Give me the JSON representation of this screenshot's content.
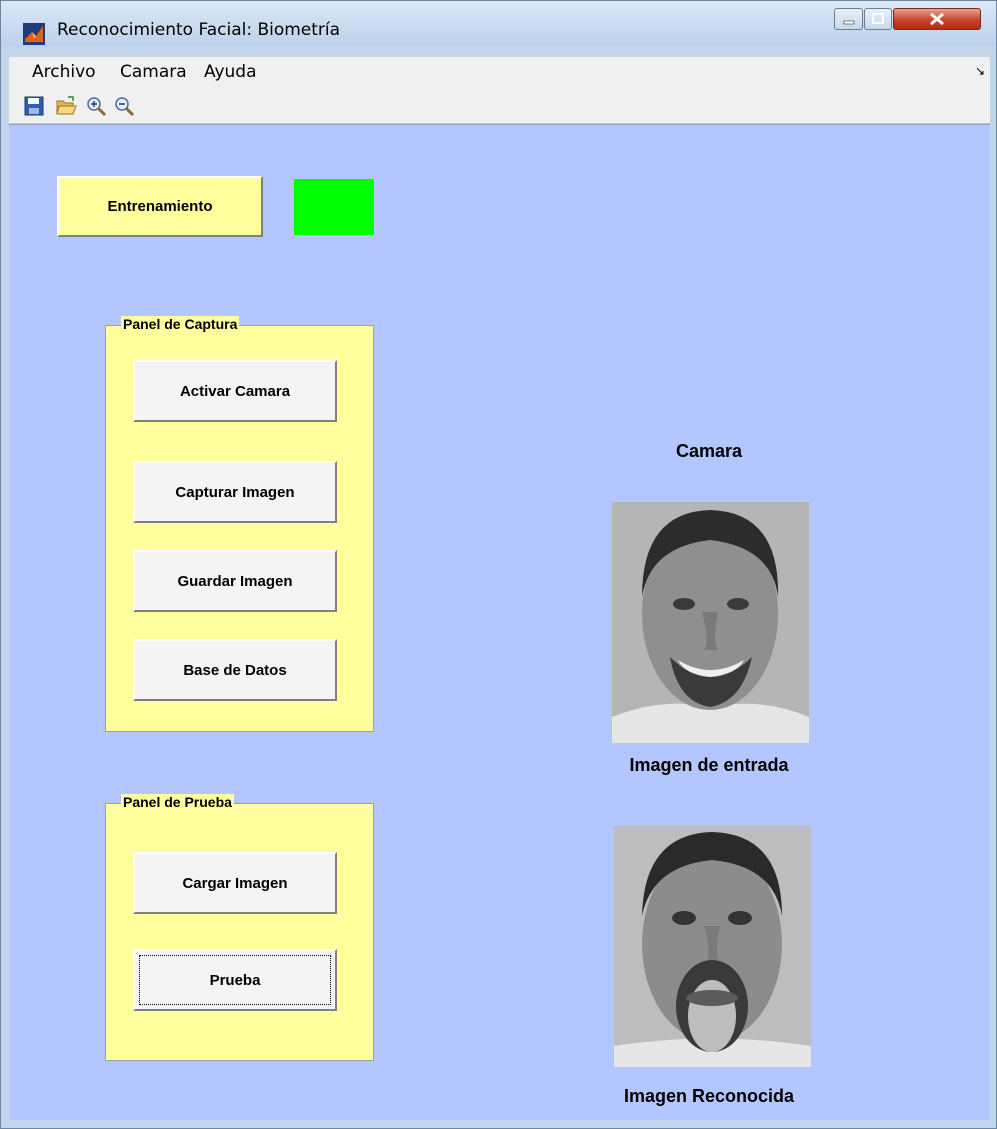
{
  "window": {
    "title": "Reconocimiento Facial: Biometría"
  },
  "menu": {
    "items": [
      "Archivo",
      "Camara",
      "Ayuda"
    ]
  },
  "toolbar": {
    "icons": [
      "save-icon",
      "open-folder-icon",
      "zoom-in-icon",
      "zoom-out-icon"
    ]
  },
  "main": {
    "train_button": "Entrenamiento",
    "status_color": "#00ff00",
    "camera_label": "Camara",
    "input_image_label": "Imagen de entrada",
    "recognized_image_label": "Imagen Reconocida"
  },
  "panel_captura": {
    "title": "Panel de Captura",
    "buttons": [
      "Activar Camara",
      "Capturar Imagen",
      "Guardar  Imagen",
      "Base de Datos"
    ]
  },
  "panel_prueba": {
    "title": "Panel de Prueba",
    "buttons": [
      "Cargar Imagen",
      "Prueba"
    ]
  },
  "colors": {
    "background": "#b3c6ff",
    "panel": "#ffff9d",
    "button": "#f4f4f4"
  }
}
